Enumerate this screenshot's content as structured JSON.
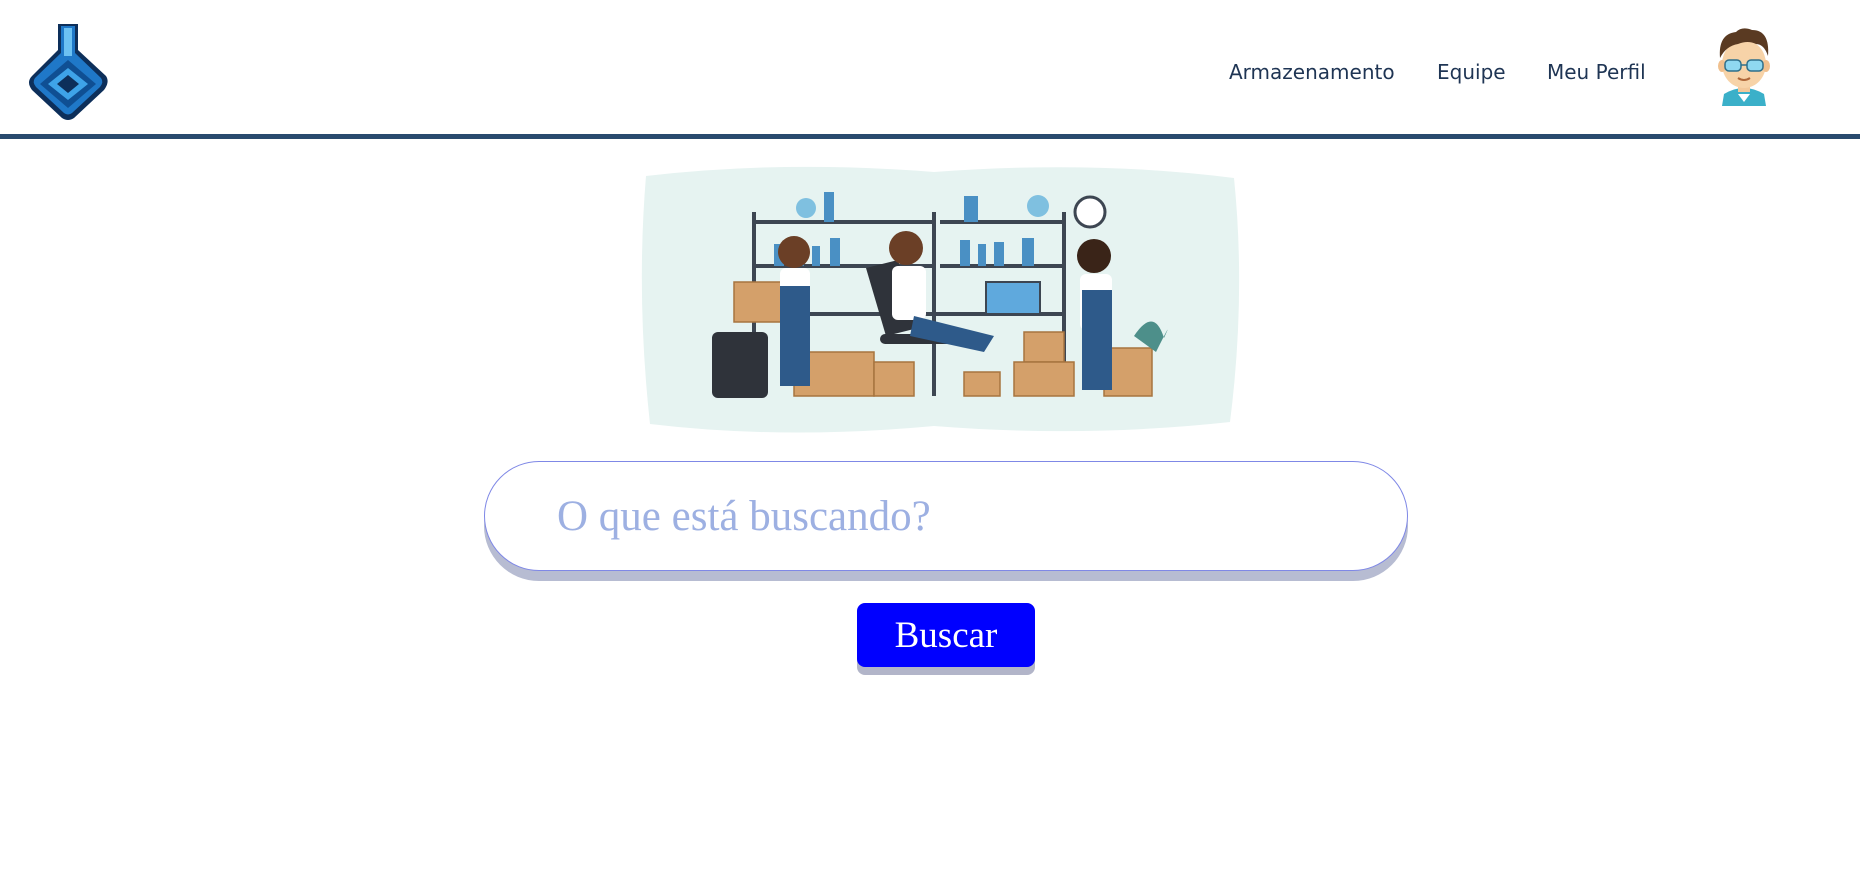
{
  "header": {
    "logo_icon": "lab-flask-logo-icon",
    "nav": [
      {
        "label": "Armazenamento"
      },
      {
        "label": "Equipe"
      },
      {
        "label": "Meu Perfil"
      }
    ],
    "avatar_icon": "user-avatar-icon"
  },
  "hero": {
    "illustration_icon": "lab-storage-team-illustration"
  },
  "search": {
    "placeholder": "O que está buscando?",
    "value": "",
    "button_label": "Buscar"
  },
  "colors": {
    "header_border": "#294a6e",
    "nav_text": "#1f3554",
    "placeholder": "#9db0e2",
    "search_border": "#7f88e6",
    "button_bg": "#0000ff",
    "button_text": "#ffffff"
  }
}
